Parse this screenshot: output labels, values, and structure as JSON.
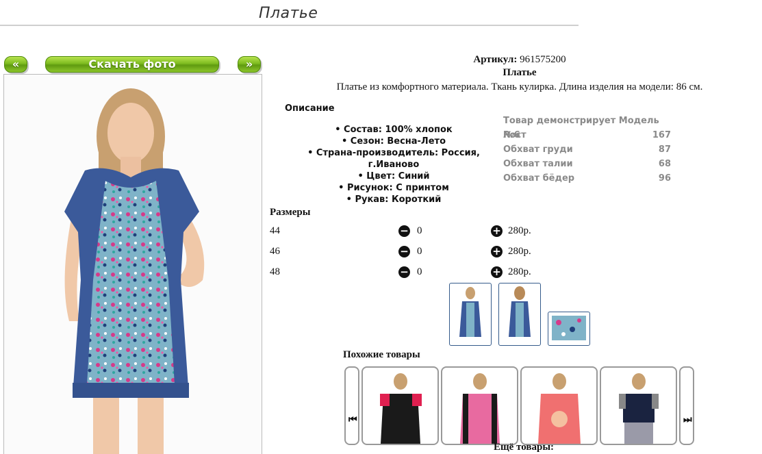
{
  "header": {
    "title": "Платье"
  },
  "buttons": {
    "prev": "«",
    "download": "Скачать фото",
    "next": "»"
  },
  "product": {
    "article_label": "Артикул:",
    "article_value": "961575200",
    "name": "Платье",
    "description": "Платье из комфортного материала. Ткань кулирка. Длина изделия на модели: 86 см."
  },
  "description_section": {
    "heading": "Описание",
    "items": [
      "• Состав: 100% хлопок",
      "• Сезон: Весна-Лето",
      "• Страна-производитель: Россия, г.Иваново",
      "• Цвет: Синий",
      "• Рисунок: С принтом",
      "• Рукав: Короткий"
    ]
  },
  "model": {
    "heading": "Товар демонстрирует Модель №6",
    "rows": [
      {
        "label": "Рост",
        "value": "167"
      },
      {
        "label": "Обхват груди",
        "value": "87"
      },
      {
        "label": "Обхват талии",
        "value": "68"
      },
      {
        "label": "Обхват бёдер",
        "value": "96"
      }
    ]
  },
  "sizes": {
    "heading": "Размеры",
    "rows": [
      {
        "size": "44",
        "qty": "0",
        "price": "280р."
      },
      {
        "size": "46",
        "qty": "0",
        "price": "280р."
      },
      {
        "size": "48",
        "qty": "0",
        "price": "280р."
      }
    ],
    "minus_icon": "minus-circle-icon",
    "plus_icon": "plus-circle-icon"
  },
  "similar": {
    "heading": "Похожие товары",
    "prev_icon": "⏮",
    "next_icon": "⏭"
  },
  "more": {
    "heading": "Ещё товары:"
  },
  "colors": {
    "accent_green": "#7dbb1f",
    "dress_blue": "#3b5a9a"
  }
}
